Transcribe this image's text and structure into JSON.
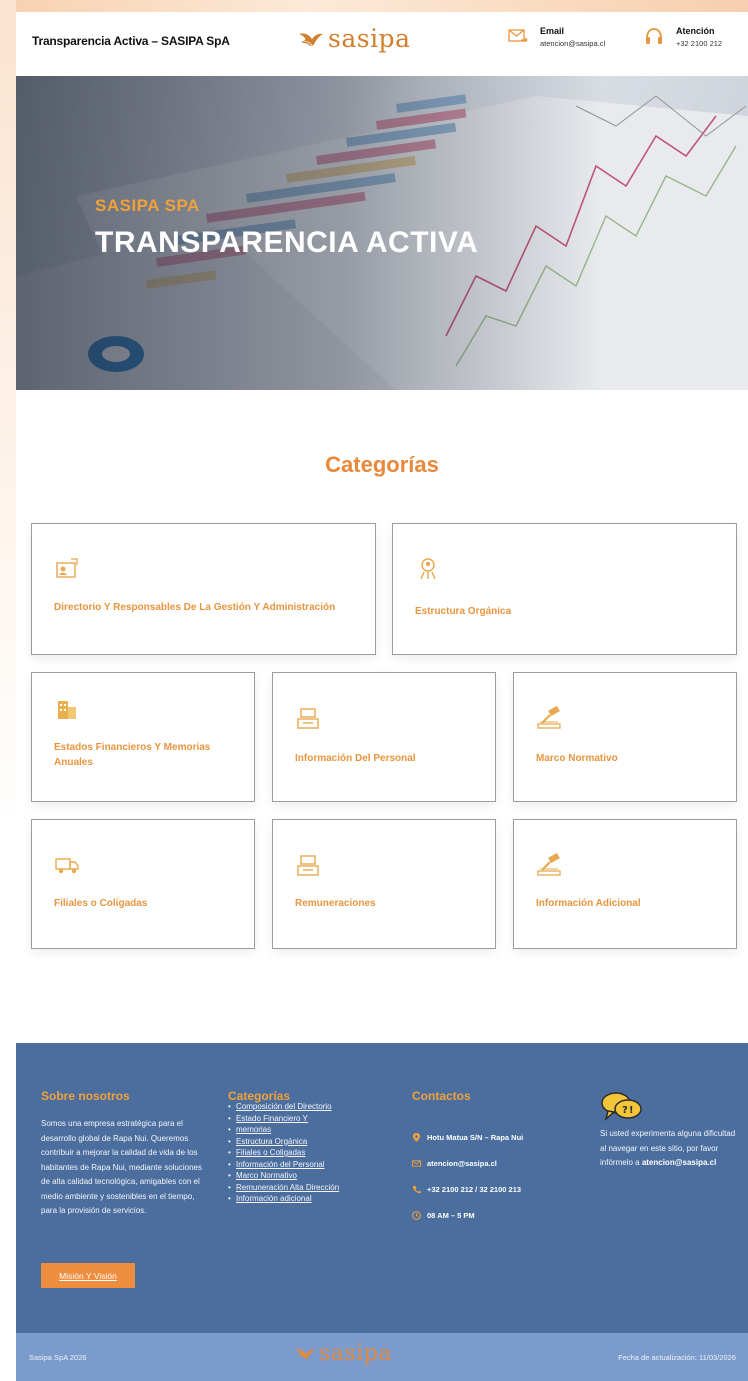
{
  "header": {
    "site_title": "Transparencia Activa – SASIPA SpA",
    "logo_text": "sasipa",
    "email_label": "Email",
    "email_value": "atencion@sasipa.cl",
    "phone_label": "Atención",
    "phone_value": "+32 2100 212"
  },
  "hero": {
    "subtitle": "SASIPA SPA",
    "title": "TRANSPARENCIA ACTIVA"
  },
  "categories": {
    "heading": "Categorías",
    "items": [
      {
        "label": "Directorio Y Responsables De La Gestión Y Administración",
        "icon": "directory-icon"
      },
      {
        "label": "Estructura Orgánica",
        "icon": "org-structure-icon"
      },
      {
        "label": "Estados Financieros Y Memorias Anuales",
        "icon": "building-icon"
      },
      {
        "label": "Información Del Personal",
        "icon": "personnel-icon"
      },
      {
        "label": "Marco Normativo",
        "icon": "gavel-icon"
      },
      {
        "label": "Filiales o Coligadas",
        "icon": "truck-icon"
      },
      {
        "label": "Remuneraciones",
        "icon": "payroll-icon"
      },
      {
        "label": "Información Adicional",
        "icon": "gavel-icon"
      }
    ]
  },
  "footer": {
    "about_title": "Sobre nosotros",
    "about_text": "Somos una empresa estratégica para el desarrollo global de Rapa Nui. Queremos contribuir a mejorar la calidad de vida de los habitantes de Rapa Nui, mediante soluciones de alta calidad tecnológica, amigables con el medio ambiente y sostenibles en el tiempo, para la provisión de servicios.",
    "about_button": "Misión Y Visión",
    "categories_title": "Categorías",
    "category_links": [
      "Composición del Directorio",
      "Estado Financiero Y",
      "memorias",
      "Estructura Orgánica",
      "Filiales o Coligadas",
      "Información del Personal",
      "Marco Normativo",
      "Remuneración Alta Dirección",
      "Información adicional"
    ],
    "contact_title": "Contactos",
    "contact_address": "Hotu Matua S/N – Rapa Nui",
    "contact_email": "atencion@sasipa.cl",
    "contact_phone": "+32 2100 212 / 32 2100 213",
    "contact_hours": "08 AM – 5 PM",
    "help_text": "Si usted experimenta alguna dificultad al navegar en este sitio, por favor infórmelo a",
    "help_email": "atencion@sasipa.cl"
  },
  "bottom_bar": {
    "copyright": "Sasipa SpA 2026",
    "logo_text": "sasipa",
    "updated": "Fecha de actualización: 11/03/2026"
  },
  "colors": {
    "accent_orange": "#e8883a",
    "footer_blue": "#4b6e9f",
    "bottom_bar_blue": "#7c9bcd",
    "button_orange": "#f08e3f"
  }
}
